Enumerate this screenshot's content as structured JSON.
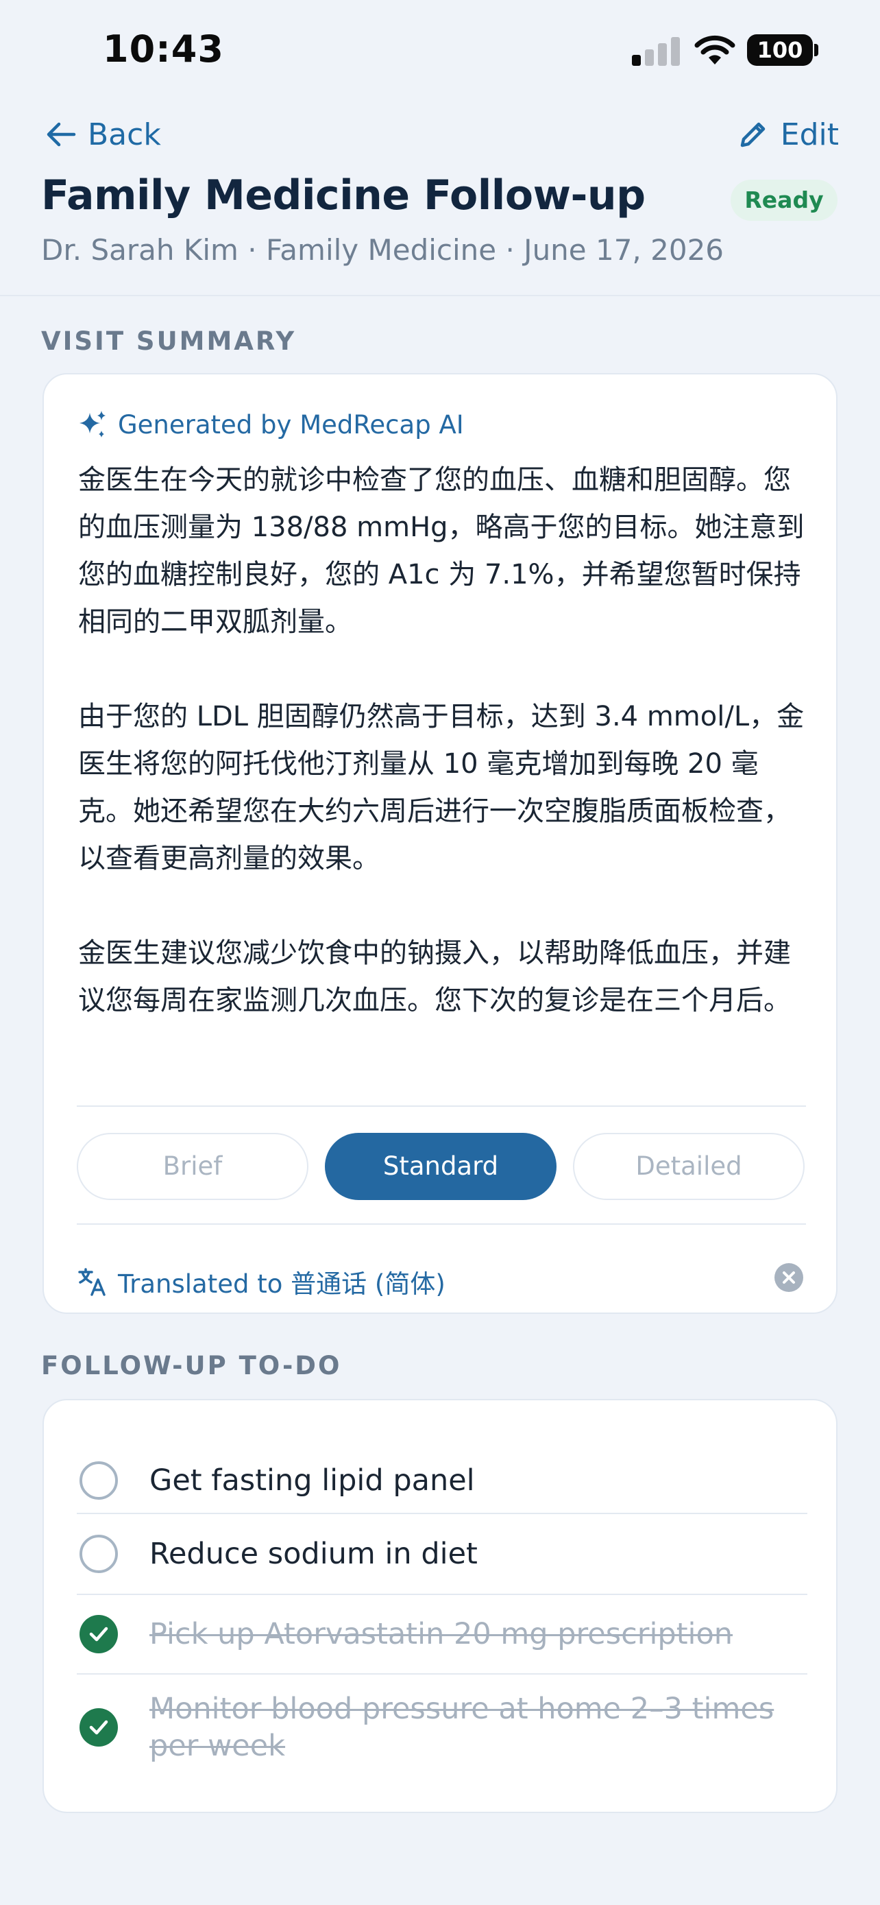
{
  "status_bar": {
    "time": "10:43",
    "battery": "100"
  },
  "header": {
    "back_label": "Back",
    "edit_label": "Edit",
    "title": "Family Medicine Follow-up",
    "status": "Ready",
    "subtitle": "Dr. Sarah Kim · Family Medicine · June 17, 2026"
  },
  "summary": {
    "section_label": "VISIT SUMMARY",
    "generated_by": "Generated by MedRecap AI",
    "paragraphs": [
      "金医生在今天的就诊中检查了您的血压、血糖和胆固醇。您的血压测量为 138/88 mmHg，略高于您的目标。她注意到您的血糖控制良好，您的 A1c 为 7.1%，并希望您暂时保持相同的二甲双胍剂量。",
      "由于您的 LDL 胆固醇仍然高于目标，达到 3.4 mmol/L，金医生将您的阿托伐他汀剂量从 10 毫克增加到每晚 20 毫克。她还希望您在大约六周后进行一次空腹脂质面板检查，以查看更高剂量的效果。",
      "金医生建议您减少饮食中的钠摄入，以帮助降低血压，并建议您每周在家监测几次血压。您下次的复诊是在三个月后。"
    ],
    "levels": [
      "Brief",
      "Standard",
      "Detailed"
    ],
    "selected_level": "Standard",
    "translation_note": "Translated to 普通话 (简体)"
  },
  "todo": {
    "section_label": "FOLLOW-UP TO-DO",
    "items": [
      {
        "label": "Get fasting lipid panel",
        "done": false
      },
      {
        "label": "Reduce sodium in diet",
        "done": false
      },
      {
        "label": "Pick up Atorvastatin 20 mg prescription",
        "done": true
      },
      {
        "label": "Monitor blood pressure at home 2–3 times per week",
        "done": true
      }
    ]
  },
  "colors": {
    "accent": "#1f6aa5",
    "ready_badge": "#1f8a52",
    "done_check": "#1e7a4d",
    "background": "#eff3f9"
  }
}
